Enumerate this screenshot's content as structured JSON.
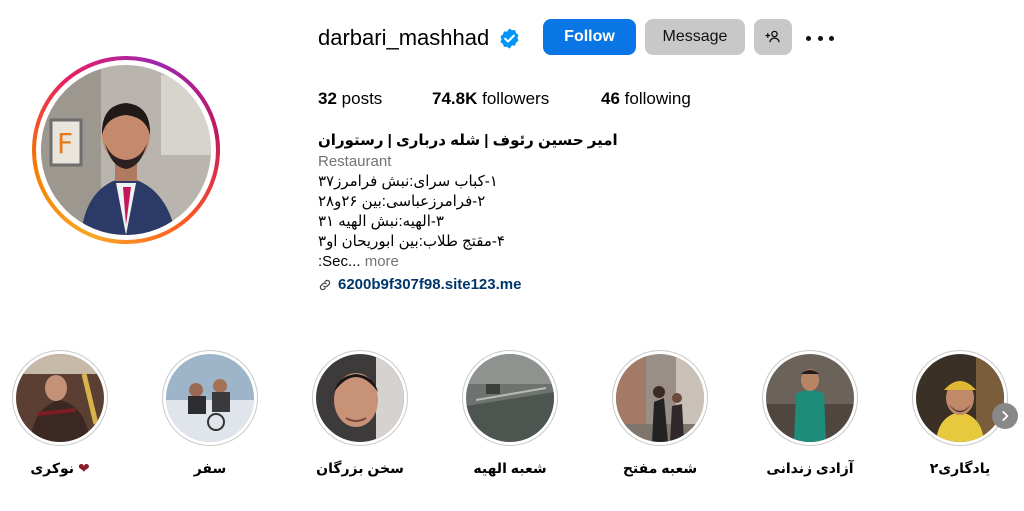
{
  "profile": {
    "username": "darbari_mashhad",
    "follow_label": "Follow",
    "message_label": "Message",
    "posts_count": "32",
    "posts_label": "posts",
    "followers_count": "74.8K",
    "followers_label": "followers",
    "following_count": "46",
    "following_label": "following"
  },
  "bio": {
    "full_name": "امیر حسین رئوف | شله درباری | رستوران",
    "category": "Restaurant",
    "lines": [
      "۱-کباب سرای:نبش فرامرز۳۷",
      "۲-فرامرزعباسی:بین ۲۶و۲۸",
      "۳-الهیه:نبش الهیه ۳۱",
      "۴-مقتج طلاب:بین ابوریحان او۳"
    ],
    "truncated": ":Sec...",
    "more_label": "more",
    "link": "6200b9f307f98.site123.me"
  },
  "highlights": [
    {
      "label": "یادگاری۲"
    },
    {
      "label": "آزادی زندانی"
    },
    {
      "label": "شعبه مفتح"
    },
    {
      "label": "شعبه الهیه"
    },
    {
      "label": "سخن بزرگان"
    },
    {
      "label": "سفر"
    },
    {
      "label": "نوکری"
    }
  ],
  "colors": {
    "follow_button": "#0a75e5",
    "secondary_button": "#c8c8c8",
    "link": "#00376b",
    "verified_badge": "#0095f6",
    "heart": "#8b1e2d"
  },
  "icons": {
    "verified": "verified-badge-icon",
    "suggest": "add-person-icon",
    "more": "more-options-icon",
    "link": "link-icon",
    "next": "chevron-right-icon"
  }
}
